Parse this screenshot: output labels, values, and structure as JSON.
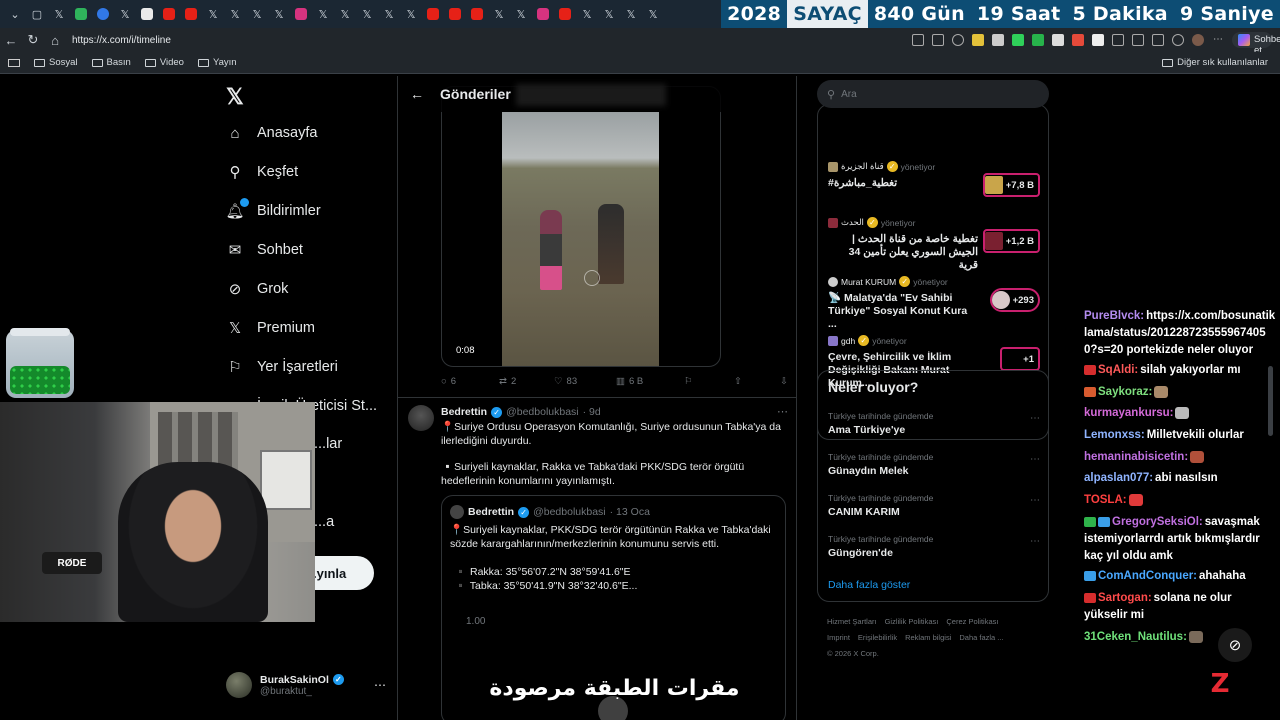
{
  "browser": {
    "url": "https://x.com/i/timeline",
    "copilot_label": "Sohbet et",
    "bookmarks": [
      "Sosyal",
      "Basın",
      "Video",
      "Yayın"
    ],
    "other_bookmarks": "Diğer sık kullanılanlar"
  },
  "countdown": {
    "year": "2028",
    "label": "SAYAÇ",
    "days": "840 Gün",
    "hours": "19 Saat",
    "minutes": "5 Dakika",
    "seconds": "9 Saniye"
  },
  "nav": {
    "items": [
      "Anasayfa",
      "Keşfet",
      "Bildirimler",
      "Sohbet",
      "Grok",
      "Premium",
      "Yer İşaretleri",
      "İçerik Üreticisi St...",
      "...lar",
      "...a"
    ],
    "post_button": "...yınla"
  },
  "account": {
    "name": "BurakSakinOl",
    "handle": "@buraktut_"
  },
  "main": {
    "header_title": "Gönderiler",
    "video_time": "0:08",
    "stats": {
      "replies": "6",
      "reposts": "2",
      "likes": "83",
      "views": "6 B"
    },
    "tweet": {
      "name": "Bedrettin",
      "handle": "@bedbolukbasi",
      "age": "· 9d",
      "text1": "📍Suriye Ordusu Operasyon Komutanlığı, Suriye ordusunun Tabka'ya da ilerlediğini duyurdu.",
      "text2": "▫️Suriyeli kaynaklar, Rakka ve Tabka'daki PKK/SDG terör örgütü hedeflerinin konumlarını yayınlamıştı."
    },
    "quote": {
      "name": "Bedrettin",
      "handle": "@bedbolukbasi",
      "age": "· 13 Oca",
      "text": "📍Suriyeli kaynaklar, PKK/SDG terör örgütünün Rakka ve Tabka'daki sözde karargahlarının/merkezlerinin konumunu servis etti.",
      "line1": "▪️ Rakka: 35°56'07.2\"N 38°59'41.6\"E",
      "line2": "▪️ Tabka: 35°50'41.9\"N 38°32'40.6\"E...",
      "value": "1.00",
      "arabic": "مقرات الطبقة مرصودة"
    }
  },
  "right": {
    "search_placeholder": "Ara",
    "live_items": [
      {
        "by": "قناة الجزيرة",
        "status": "yönetiyor",
        "headline": "#تغطية_مباشرة",
        "count": "+7,8 B"
      },
      {
        "by": "الحدث",
        "status": "yönetiyor",
        "headline": "تغطية خاصة من قناة الحدث | الجيش السوري يعلن تأمين 34 قرية",
        "count": "+1,2 B"
      },
      {
        "by": "Murat KURUM",
        "status": "yönetiyor",
        "headline": "📡 Malatya'da \"Ev Sahibi Türkiye\" Sosyal Konut Kura ...",
        "count": "+293"
      },
      {
        "by": "gdh",
        "status": "yönetiyor",
        "headline": "Çevre, Şehircilik ve İklim Değişikliği Bakanı Murat Kurum...",
        "count": "+1"
      }
    ],
    "trends_title": "Neler oluyor?",
    "trends": [
      {
        "context": "Türkiye tarihinde gündemde",
        "name": "Ama Türkiye'ye"
      },
      {
        "context": "Türkiye tarihinde gündemde",
        "name": "Günaydın Melek"
      },
      {
        "context": "Türkiye tarihinde gündemde",
        "name": "CANIM KARIM"
      },
      {
        "context": "Türkiye tarihinde gündemde",
        "name": "Güngören'de"
      }
    ],
    "show_more": "Daha fazla göster",
    "footer": [
      "Hizmet Şartları",
      "Gizlilik Politikası",
      "Çerez Politikası",
      "Imprint",
      "Erişilebilirlik",
      "Reklam bilgisi",
      "Daha fazla ...",
      "© 2026 X Corp."
    ]
  },
  "chat": [
    {
      "user": "PureBlvck:",
      "color": "#b48cf0",
      "text": "https://x.com/bosunatiklama/status/2012287235559674050?s=20 portekizde neler oluyor"
    },
    {
      "user": "SqAldi:",
      "color": "#ff5a5a",
      "text": "silah yakıyorlar mı"
    },
    {
      "user": "Saykoraz:",
      "color": "#7fe07f",
      "text": ""
    },
    {
      "user": "kurmayankursu:",
      "color": "#d46ad8",
      "text": ""
    },
    {
      "user": "Lemonxss:",
      "color": "#8fb4ff",
      "text": "Milletvekili olurlar"
    },
    {
      "user": "hemaninabisicetin:",
      "color": "#c070e0",
      "text": ""
    },
    {
      "user": "alpaslan077:",
      "color": "#8fb4ff",
      "text": "abi nasılsın"
    },
    {
      "user": "TOSLA:",
      "color": "#ff4040",
      "text": ""
    },
    {
      "user": "GregorySeksiOl:",
      "color": "#c070e0",
      "text": "savaşmak istemiyorlarrdı artık bıkmışlardır kaç yıl oldu amk"
    },
    {
      "user": "ComAndConquer:",
      "color": "#4aa8ff",
      "text": "ahahaha"
    },
    {
      "user": "Sartogan:",
      "color": "#ff4b4b",
      "text": "solana ne olur yükselir mi"
    },
    {
      "user": "31Ceken_Nautilus:",
      "color": "#6fe07a",
      "text": ""
    }
  ],
  "webcam": {
    "mic_label": "RØDE"
  },
  "colors": {
    "accent": "#1d9bf0",
    "countdown_bg": "#0d4d74",
    "live_pill": "#c9206e"
  }
}
